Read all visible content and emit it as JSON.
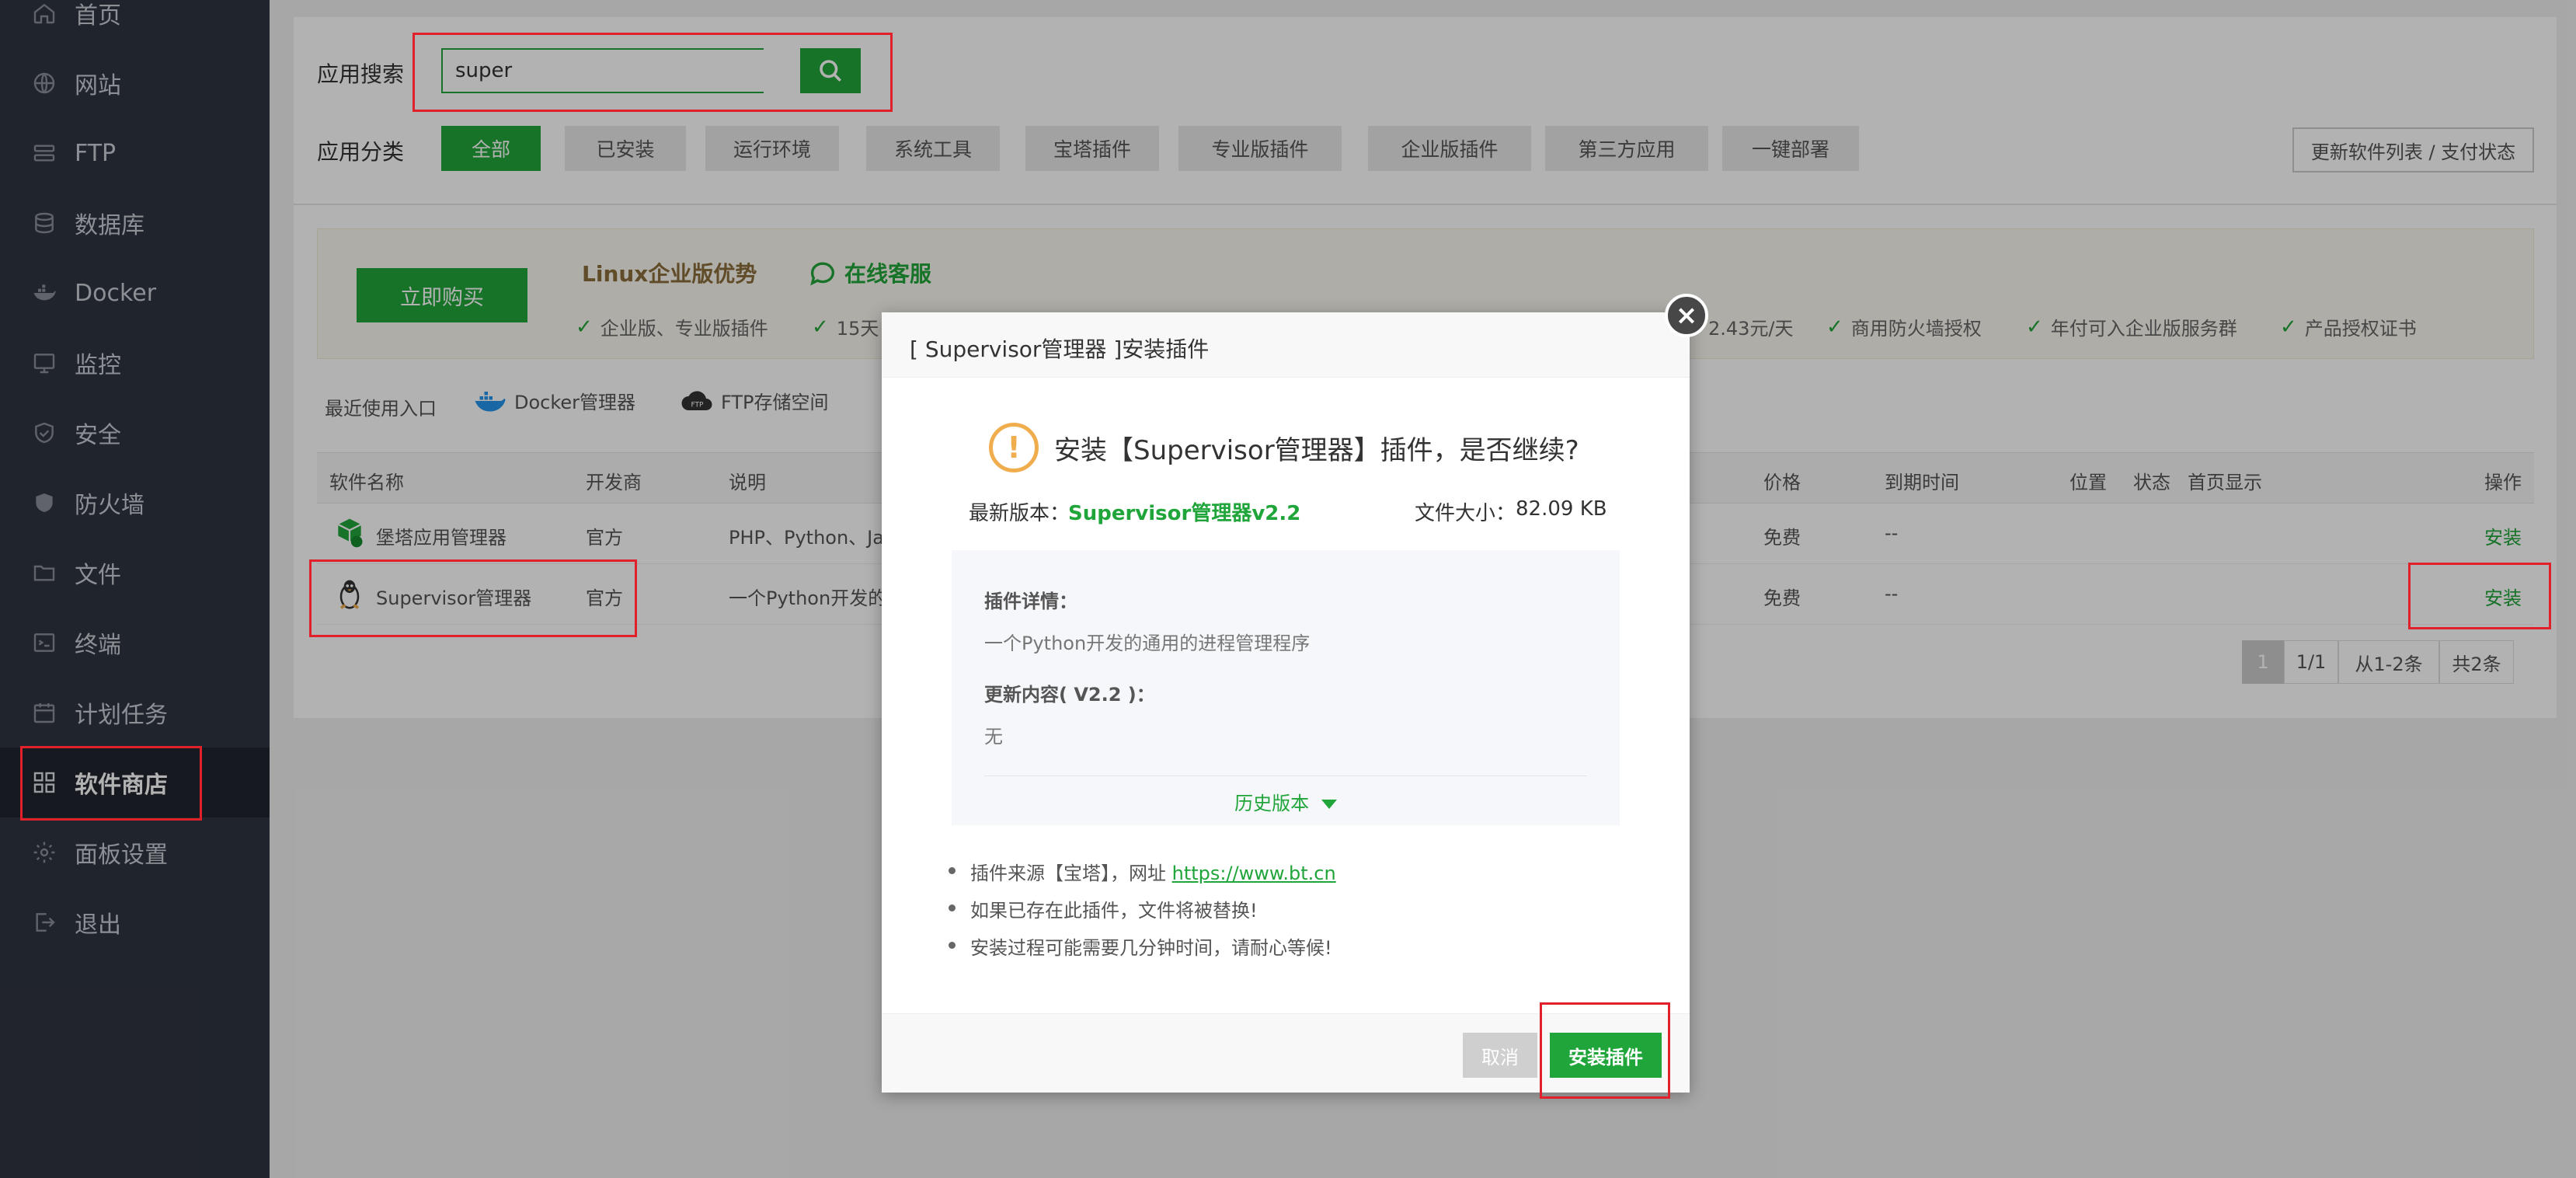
{
  "sidebar": {
    "items": [
      {
        "label": "首页"
      },
      {
        "label": "网站"
      },
      {
        "label": "FTP"
      },
      {
        "label": "数据库"
      },
      {
        "label": "Docker"
      },
      {
        "label": "监控"
      },
      {
        "label": "安全"
      },
      {
        "label": "防火墙"
      },
      {
        "label": "文件"
      },
      {
        "label": "终端"
      },
      {
        "label": "计划任务"
      },
      {
        "label": "软件商店"
      },
      {
        "label": "面板设置"
      },
      {
        "label": "退出"
      }
    ],
    "active_index": 11
  },
  "search": {
    "label": "应用搜索",
    "value": "super"
  },
  "categories": {
    "label": "应用分类",
    "tabs": [
      "全部",
      "已安装",
      "运行环境",
      "系统工具",
      "宝塔插件",
      "专业版插件",
      "企业版插件",
      "第三方应用",
      "一键部署"
    ],
    "active_index": 0,
    "update_button": "更新软件列表 / 支付状态"
  },
  "promo": {
    "buy_button": "立即购买",
    "title": "Linux企业版优势",
    "service": "在线客服",
    "features": [
      "企业版、专业版插件",
      "15天",
      "2.43元/天",
      "商用防火墙授权",
      "年付可入企业版服务群",
      "产品授权证书"
    ]
  },
  "recent": {
    "label": "最近使用入口",
    "items": [
      "Docker管理器",
      "FTP存储空间"
    ]
  },
  "table": {
    "headers": [
      "软件名称",
      "开发商",
      "说明",
      "价格",
      "到期时间",
      "位置",
      "状态",
      "首页显示",
      "操作"
    ],
    "rows": [
      {
        "name": "堡塔应用管理器",
        "developer": "官方",
        "desc": "PHP、Python、Ja",
        "price": "免费",
        "expire": "--",
        "action": "安装"
      },
      {
        "name": "Supervisor管理器",
        "developer": "官方",
        "desc": "一个Python开发的",
        "price": "免费",
        "expire": "--",
        "action": "安装"
      }
    ]
  },
  "pagination": {
    "current": "1",
    "pages": "1/1",
    "range": "从1-2条",
    "total": "共2条"
  },
  "dialog": {
    "title": "[ Supervisor管理器 ]安装插件",
    "close": "×",
    "warn_glyph": "!",
    "question": "安装【Supervisor管理器】插件，是否继续?",
    "version_label": "最新版本：",
    "version_value": "Supervisor管理器v2.2",
    "size_label": "文件大小：",
    "size_value": "82.09 KB",
    "details_heading": "插件详情：",
    "details_text": "一个Python开发的通用的进程管理程序",
    "update_heading": "更新内容( V2.2 )：",
    "update_text": "无",
    "history": "历史版本",
    "note1_prefix": "插件来源【宝塔】，网址 ",
    "note1_link": "https://www.bt.cn",
    "note2": "如果已存在此插件，文件将被替换!",
    "note3": "安装过程可能需要几分钟时间，请耐心等候!",
    "cancel": "取消",
    "install": "安装插件"
  },
  "colors": {
    "accent": "#20a53a",
    "sidebar_bg": "#2f3441",
    "highlight": "#e0202a",
    "warning": "#f0ad4e"
  }
}
